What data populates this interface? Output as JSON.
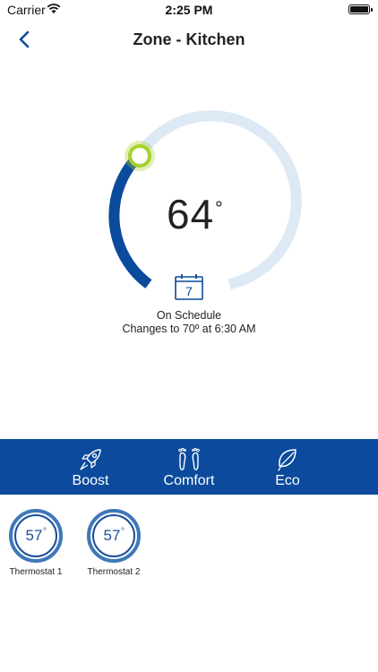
{
  "status_bar": {
    "carrier": "Carrier",
    "time": "2:25 PM"
  },
  "nav": {
    "title": "Zone - Kitchen"
  },
  "dial": {
    "current_temp": "64",
    "degree_symbol": "°",
    "calendar_day": "7",
    "schedule_status": "On Schedule",
    "schedule_change": "Changes to 70º at 6:30 AM",
    "colors": {
      "active_arc": "#0b4a9c",
      "track_arc": "#dde9f4",
      "handle": "#a6d12c"
    }
  },
  "modes": [
    {
      "label": "Boost",
      "icon": "rocket-icon"
    },
    {
      "label": "Comfort",
      "icon": "footprints-icon"
    },
    {
      "label": "Eco",
      "icon": "leaf-icon"
    }
  ],
  "thermostats": [
    {
      "name": "Thermostat 1",
      "temp": "57",
      "degree": "°"
    },
    {
      "name": "Thermostat 2",
      "temp": "57",
      "degree": "°"
    }
  ],
  "colors": {
    "primary": "#0b4a9c",
    "accent": "#1b4f9c"
  }
}
